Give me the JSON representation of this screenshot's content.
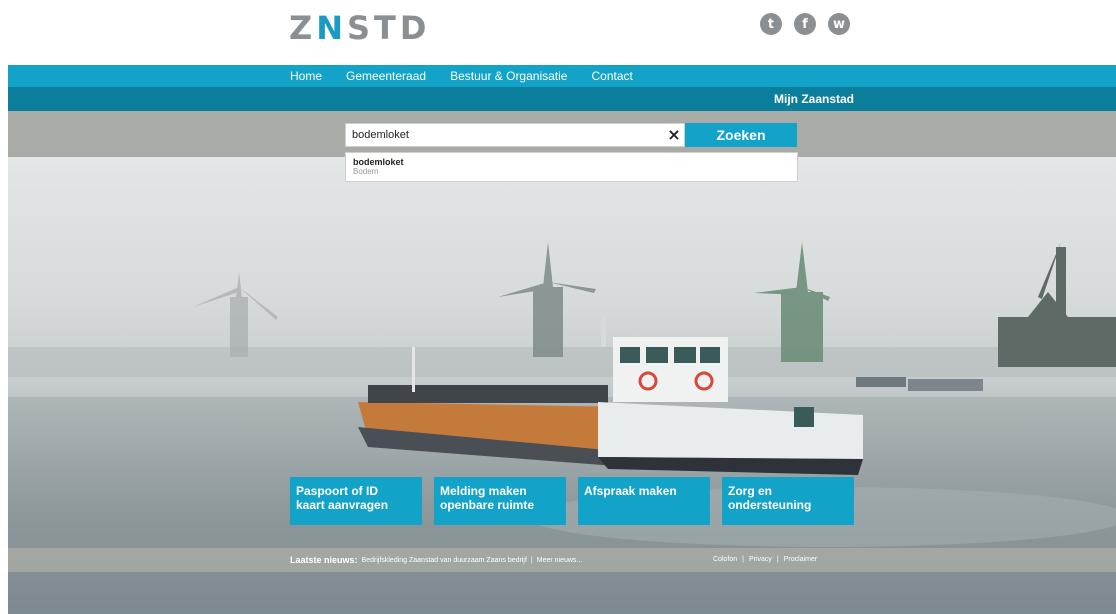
{
  "header": {
    "logo_prefix": "Z",
    "logo_accent": "N",
    "logo_suffix": "STD",
    "socials": [
      {
        "icon": "twitter-icon",
        "glyph": "t"
      },
      {
        "icon": "facebook-icon",
        "glyph": "f"
      },
      {
        "icon": "whatsapp-icon",
        "glyph": "w"
      }
    ]
  },
  "nav": {
    "items": [
      "Home",
      "Gemeenteraad",
      "Bestuur & Organisatie",
      "Contact"
    ],
    "mijn": "Mijn Zaanstad"
  },
  "search": {
    "value": "bodemloket",
    "clear_icon": "×",
    "button": "Zoeken",
    "suggestion": {
      "title": "bodemloket",
      "subtitle": "Bodem"
    }
  },
  "tiles": [
    {
      "line1": "Paspoort of ID",
      "line2": "kaart aanvragen"
    },
    {
      "line1": "Melding maken",
      "line2": "openbare ruimte"
    },
    {
      "line1": "Afspraak maken",
      "line2": ""
    },
    {
      "line1": "Zorg en",
      "line2": "ondersteuning"
    }
  ],
  "footer": {
    "news_label": "Laatste nieuws:",
    "news_item": "Bedrijfskleding Zaanstad van duurzaam Zaans bedrijf",
    "separator": "|",
    "more": "Meer nieuws...",
    "links": [
      "Colofon",
      "Privacy",
      "Proclaimer"
    ]
  },
  "colors": {
    "accent": "#13a3c8",
    "subbar": "#0b7e9c",
    "logo_gray": "#8a8f94",
    "search_band": "#a9aba6"
  }
}
